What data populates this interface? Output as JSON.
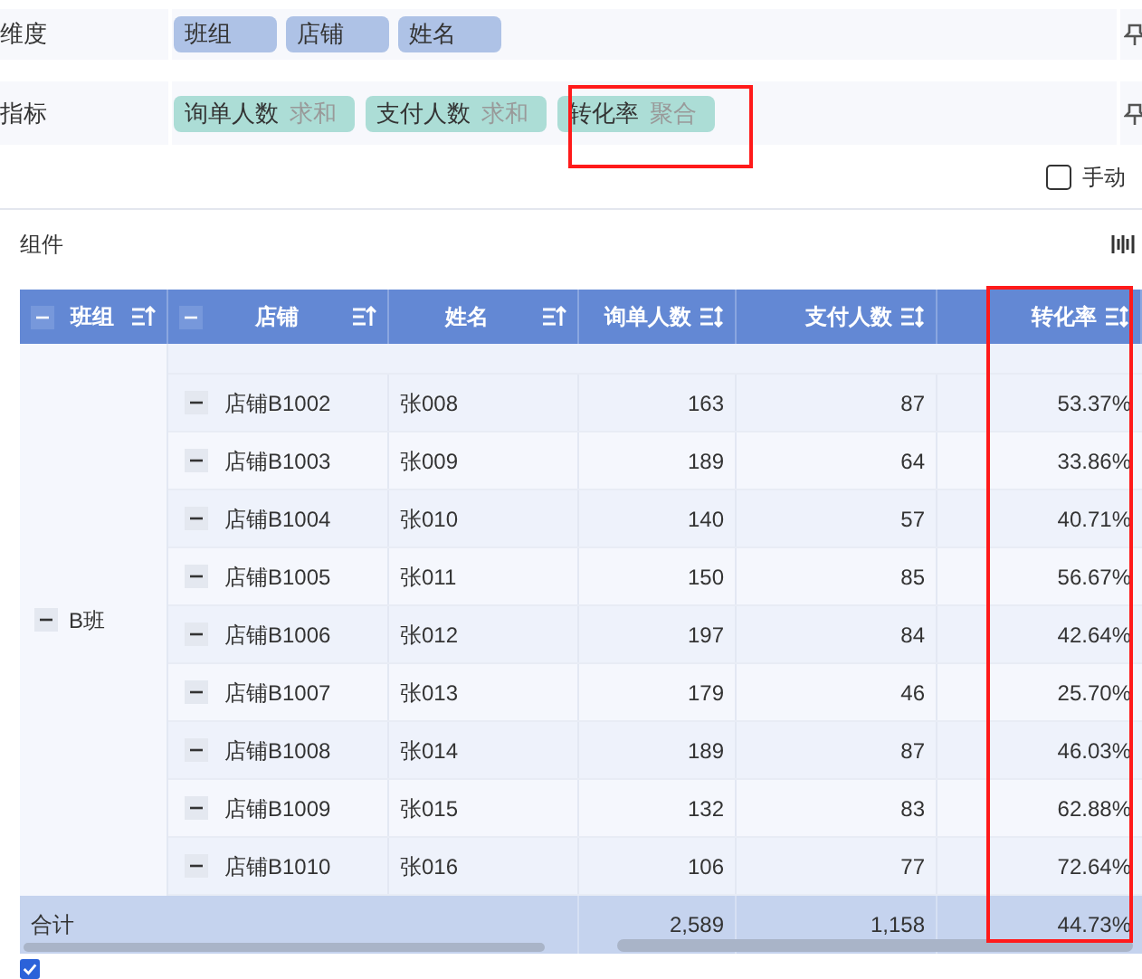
{
  "dimensions": {
    "label": "维度",
    "chips": [
      "班组",
      "店铺",
      "姓名"
    ]
  },
  "measures": {
    "label": "指标",
    "chips": [
      {
        "name": "询单人数",
        "agg": "求和"
      },
      {
        "name": "支付人数",
        "agg": "求和"
      },
      {
        "name": "转化率",
        "agg": "聚合"
      }
    ]
  },
  "manual_preview": {
    "label": "手动",
    "checked": false
  },
  "component": {
    "label": "组件"
  },
  "table": {
    "columns": [
      {
        "label": "班组",
        "kind": "dimension",
        "collapsible": true
      },
      {
        "label": "店铺",
        "kind": "dimension",
        "collapsible": true
      },
      {
        "label": "姓名",
        "kind": "dimension",
        "collapsible": false
      },
      {
        "label": "询单人数",
        "kind": "measure",
        "collapsible": false
      },
      {
        "label": "支付人数",
        "kind": "measure",
        "collapsible": false
      },
      {
        "label": "转化率",
        "kind": "measure",
        "collapsible": false
      }
    ],
    "group": {
      "label": "B班",
      "expanded": true
    },
    "rows": [
      {
        "store": "店铺B1002",
        "name": "张008",
        "inquiries": "163",
        "payments": "87",
        "rate": "53.37%",
        "expanded": true
      },
      {
        "store": "店铺B1003",
        "name": "张009",
        "inquiries": "189",
        "payments": "64",
        "rate": "33.86%",
        "expanded": true
      },
      {
        "store": "店铺B1004",
        "name": "张010",
        "inquiries": "140",
        "payments": "57",
        "rate": "40.71%",
        "expanded": true
      },
      {
        "store": "店铺B1005",
        "name": "张011",
        "inquiries": "150",
        "payments": "85",
        "rate": "56.67%",
        "expanded": true
      },
      {
        "store": "店铺B1006",
        "name": "张012",
        "inquiries": "197",
        "payments": "84",
        "rate": "42.64%",
        "expanded": true
      },
      {
        "store": "店铺B1007",
        "name": "张013",
        "inquiries": "179",
        "payments": "46",
        "rate": "25.70%",
        "expanded": true
      },
      {
        "store": "店铺B1008",
        "name": "张014",
        "inquiries": "189",
        "payments": "87",
        "rate": "46.03%",
        "expanded": true
      },
      {
        "store": "店铺B1009",
        "name": "张015",
        "inquiries": "132",
        "payments": "83",
        "rate": "62.88%",
        "expanded": true
      },
      {
        "store": "店铺B1010",
        "name": "张016",
        "inquiries": "106",
        "payments": "77",
        "rate": "72.64%",
        "expanded": true
      }
    ],
    "total": {
      "label": "合计",
      "inquiries": "2,589",
      "payments": "1,158",
      "rate": "44.73%"
    }
  },
  "show_all": {
    "checked": true
  }
}
